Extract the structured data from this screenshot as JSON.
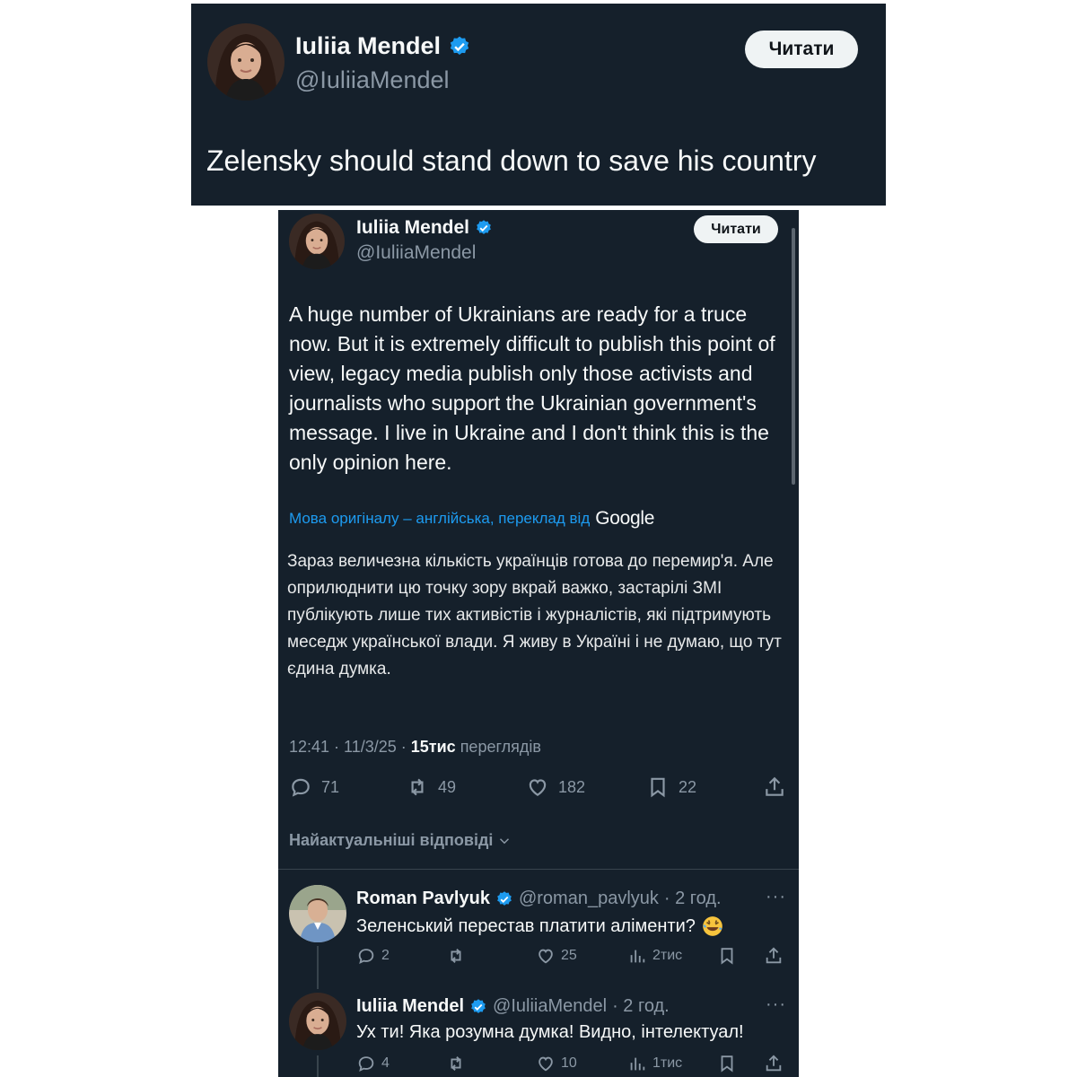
{
  "top_card": {
    "name": "Iuliia Mendel",
    "handle": "@IuliiaMendel",
    "follow_label": "Читати",
    "text": "Zelensky should stand down to save his country"
  },
  "tweet": {
    "name": "Iuliia Mendel",
    "handle": "@IuliiaMendel",
    "follow_label": "Читати",
    "text": "A huge number of Ukrainians are ready for a truce now. But it is extremely difficult to publish this point of view, legacy media publish only those activists and journalists who support the Ukrainian government's message. I live in Ukraine and I don't think this is the only opinion here.",
    "translation_note": "Мова оригіналу – англійська, переклад від",
    "translation_provider": "Google",
    "translated_text": "Зараз величезна кількість українців готова до перемир'я. Але оприлюднити цю точку зору вкрай важко, застарілі ЗМІ публікують лише тих активістів і журналістів, які підтримують меседж української влади. Я живу в Україні і не думаю, що тут єдина думка.",
    "time": "12:41 · 11/3/25 · ",
    "views_count": "15тис",
    "views_label": " переглядів",
    "replies": "71",
    "reposts": "49",
    "likes": "182",
    "bookmarks": "22"
  },
  "sort_label": "Найактуальніші відповіді",
  "replies": [
    {
      "name": "Roman Pavlyuk",
      "handle": "@roman_pavlyuk",
      "time": "· 2 год.",
      "more": "···",
      "text": "Зеленський перестав платити аліменти?",
      "emoji": "🤣",
      "replies": "2",
      "likes": "25",
      "views": "2тис"
    },
    {
      "name": "Iuliia Mendel",
      "handle": "@IuliiaMendel",
      "time": "· 2 год.",
      "more": "···",
      "text": "Ух ти! Яка розумна думка! Видно, інтелектуал!",
      "replies": "4",
      "likes": "10",
      "views": "1тис"
    }
  ],
  "colors": {
    "background": "#15202b",
    "text": "#f7f9f9",
    "muted": "#8b98a5",
    "link": "#1d9bf0",
    "verified": "#1d9bf0",
    "divider": "#38444d"
  }
}
